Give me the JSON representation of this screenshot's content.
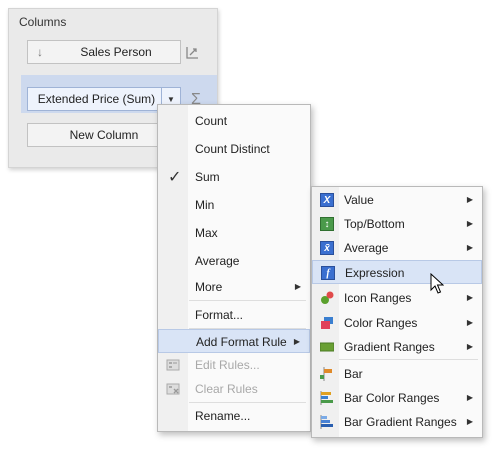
{
  "columns_panel": {
    "title": "Columns",
    "fields": [
      {
        "label": "Sales Person"
      },
      {
        "label": "Extended Price (Sum)"
      },
      {
        "label": "New Column"
      }
    ]
  },
  "context_menu": {
    "items": [
      {
        "label": "Count"
      },
      {
        "label": "Count Distinct"
      },
      {
        "label": "Sum",
        "checked": true
      },
      {
        "label": "Min"
      },
      {
        "label": "Max"
      },
      {
        "label": "Average"
      },
      {
        "label": "More",
        "submenu": true
      },
      {
        "label": "Format..."
      },
      {
        "label": "Add Format Rule",
        "submenu": true,
        "highlighted": true
      },
      {
        "label": "Edit Rules...",
        "disabled": true
      },
      {
        "label": "Clear Rules",
        "disabled": true
      },
      {
        "label": "Rename..."
      }
    ]
  },
  "format_rule_submenu": {
    "items": [
      {
        "label": "Value",
        "icon": "value-icon"
      },
      {
        "label": "Top/Bottom",
        "icon": "top-bottom-icon"
      },
      {
        "label": "Average",
        "icon": "average-icon"
      },
      {
        "label": "Expression",
        "icon": "expression-icon",
        "highlighted": true
      },
      {
        "label": "Icon Ranges",
        "icon": "icon-ranges-icon"
      },
      {
        "label": "Color Ranges",
        "icon": "color-ranges-icon"
      },
      {
        "label": "Gradient Ranges",
        "icon": "gradient-ranges-icon"
      },
      {
        "label": "Bar",
        "icon": "bar-icon"
      },
      {
        "label": "Bar Color Ranges",
        "icon": "bar-color-ranges-icon"
      },
      {
        "label": "Bar Gradient Ranges",
        "icon": "bar-gradient-ranges-icon"
      }
    ]
  },
  "colors": {
    "selection": "#cdd9ee",
    "highlight": "#d9e4f6",
    "disabled_text": "#a8a8a8"
  }
}
